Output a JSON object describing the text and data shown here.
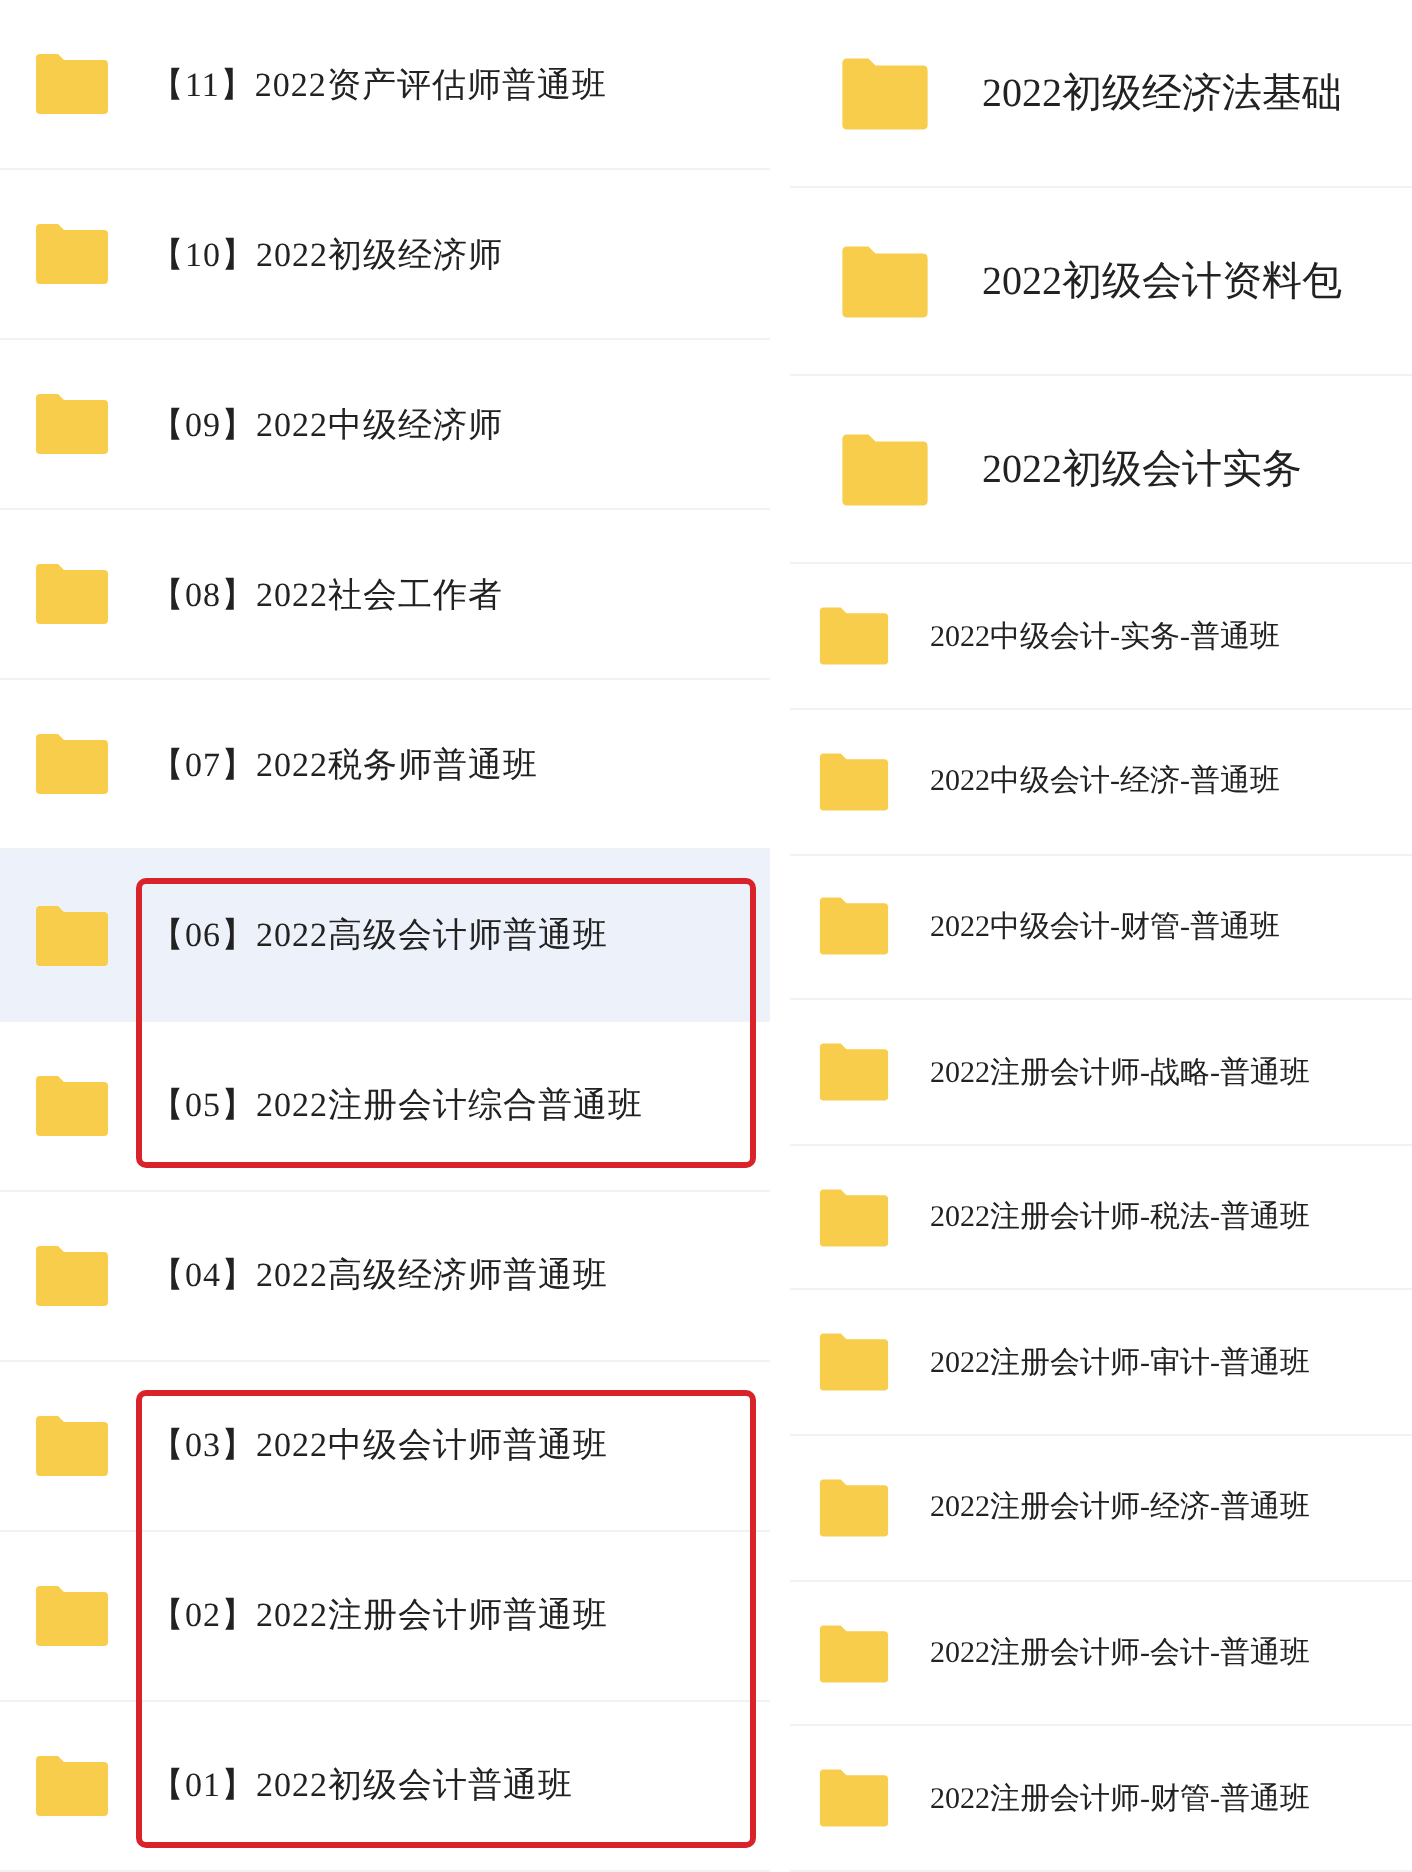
{
  "left_groups": [
    {
      "boxed": false,
      "folders": [
        {
          "name": "【11】2022资产评估师普通班",
          "selected": false
        },
        {
          "name": "【10】2022初级经济师",
          "selected": false
        },
        {
          "name": "【09】2022中级经济师",
          "selected": false
        },
        {
          "name": "【08】2022社会工作者",
          "selected": false
        },
        {
          "name": "【07】2022税务师普通班",
          "selected": false
        }
      ]
    },
    {
      "boxed": true,
      "folders": [
        {
          "name": "【06】2022高级会计师普通班",
          "selected": true
        },
        {
          "name": "【05】2022注册会计综合普通班",
          "selected": false
        }
      ]
    },
    {
      "boxed": false,
      "folders": [
        {
          "name": "【04】2022高级经济师普通班",
          "selected": false
        }
      ]
    },
    {
      "boxed": true,
      "folders": [
        {
          "name": "【03】2022中级会计师普通班",
          "selected": false
        },
        {
          "name": "【02】2022注册会计师普通班",
          "selected": false
        },
        {
          "name": "【01】2022初级会计普通班",
          "selected": false
        }
      ]
    }
  ],
  "right_folders": [
    {
      "kind": "large",
      "name": "2022初级经济法基础"
    },
    {
      "kind": "large",
      "name": "2022初级会计资料包"
    },
    {
      "kind": "large",
      "name": "2022初级会计实务"
    },
    {
      "kind": "small",
      "name": "2022中级会计-实务-普通班"
    },
    {
      "kind": "small",
      "name": "2022中级会计-经济-普通班"
    },
    {
      "kind": "small",
      "name": "2022中级会计-财管-普通班"
    },
    {
      "kind": "small",
      "name": "2022注册会计师-战略-普通班"
    },
    {
      "kind": "small",
      "name": "2022注册会计师-税法-普通班"
    },
    {
      "kind": "small",
      "name": "2022注册会计师-审计-普通班"
    },
    {
      "kind": "small",
      "name": "2022注册会计师-经济-普通班"
    },
    {
      "kind": "small",
      "name": "2022注册会计师-会计-普通班"
    },
    {
      "kind": "small",
      "name": "2022注册会计师-财管-普通班"
    }
  ]
}
